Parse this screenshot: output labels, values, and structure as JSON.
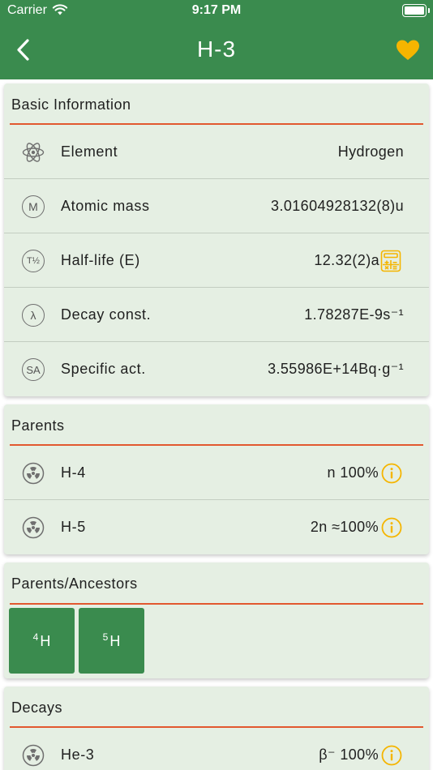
{
  "status": {
    "carrier": "Carrier",
    "time": "9:17 PM"
  },
  "nav": {
    "title": "H-3",
    "favorite_color": "#f5b500"
  },
  "basic_info": {
    "title": "Basic Information",
    "rows": [
      {
        "icon": "atom-icon",
        "label": "Element",
        "value": "Hydrogen"
      },
      {
        "icon": "mass-m-icon",
        "icon_text": "M",
        "label": "Atomic mass",
        "value": "3.01604928132(8)u"
      },
      {
        "icon": "half-life-icon",
        "icon_text": "T½",
        "label": "Half-life (E)",
        "value": "12.32(2)a"
      },
      {
        "icon": "lambda-icon",
        "icon_text": "λ",
        "label": "Decay const.",
        "value": "1.78287E-9s⁻¹"
      },
      {
        "icon": "specific-activity-icon",
        "icon_text": "SA",
        "label": "Specific act.",
        "value": "3.55986E+14Bq·g⁻¹"
      }
    ]
  },
  "parents": {
    "title": "Parents",
    "rows": [
      {
        "icon": "radiation-icon",
        "label": "H-4",
        "value": "n 100%"
      },
      {
        "icon": "radiation-icon",
        "label": "H-5",
        "value": "2n ≈100%"
      }
    ]
  },
  "ancestors": {
    "title": "Parents/Ancestors",
    "tiles": [
      {
        "mass": "4",
        "symbol": "H"
      },
      {
        "mass": "5",
        "symbol": "H"
      }
    ]
  },
  "decays": {
    "title": "Decays",
    "rows": [
      {
        "icon": "radiation-icon",
        "label": "He-3",
        "value": "β⁻ 100%"
      }
    ]
  },
  "colors": {
    "accent": "#3a8b4e",
    "card": "#e5efe3",
    "rule": "#e2582f",
    "info_icon": "#f5b500"
  }
}
